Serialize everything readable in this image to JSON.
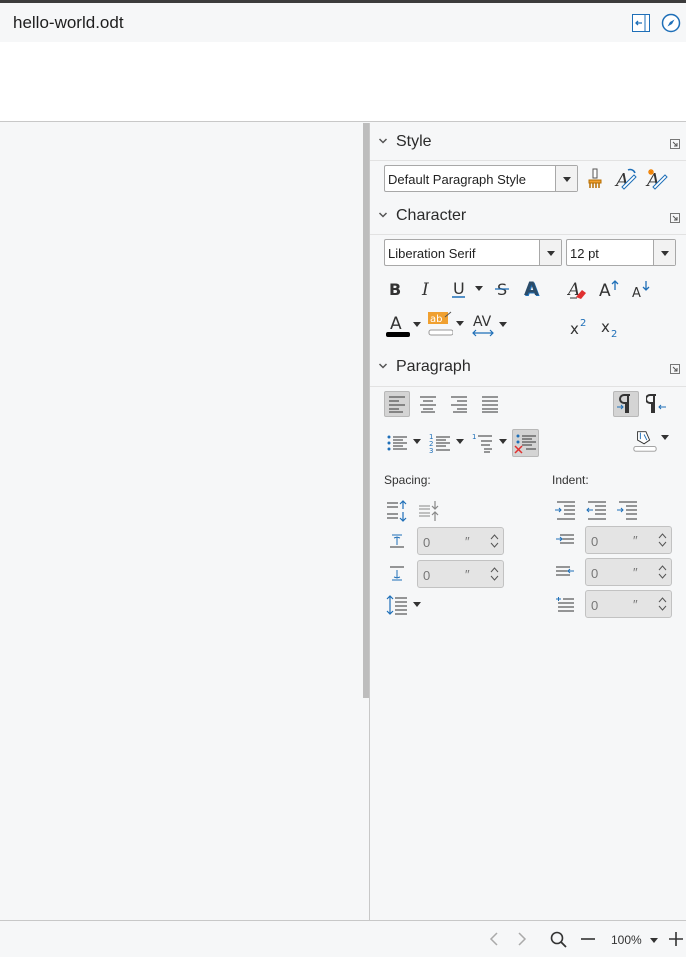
{
  "window": {
    "title": "hello-world.odt"
  },
  "sidebar": {
    "style_section": {
      "title": "Style",
      "paragraph_style": "Default Paragraph Style"
    },
    "character_section": {
      "title": "Character",
      "font_name": "Liberation Serif",
      "font_size": "12 pt"
    },
    "paragraph_section": {
      "title": "Paragraph",
      "spacing_label": "Spacing:",
      "indent_label": "Indent:",
      "above_spacing": "0",
      "below_spacing": "0",
      "before_indent": "0",
      "after_indent": "0",
      "first_line_indent": "0",
      "unit": "″"
    }
  },
  "statusbar": {
    "zoom": "100%"
  },
  "colors": {
    "accent": "#1e6fb8",
    "font_color": "#000000",
    "highlight": "#f0a030"
  }
}
